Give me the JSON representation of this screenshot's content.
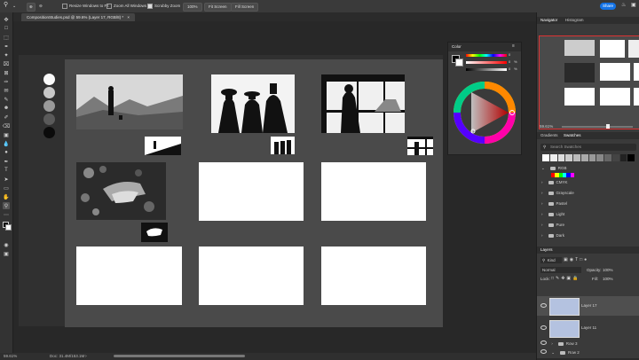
{
  "options_bar": {
    "resize_windows_label": "Resize Windows to Fit",
    "zoom_all_label": "Zoom All Windows",
    "scrubby_zoom_label": "Scrubby Zoom",
    "zoom_value": "100%",
    "fit_screen_label": "Fit Screen",
    "fill_screen_label": "Fill Screen",
    "share_label": "Share"
  },
  "document": {
    "tab_title": "CompositionStudies.psd @ 59.6% (Layer 17, RGB/8) *"
  },
  "status_bar": {
    "zoom": "59.61%",
    "doc_size": "Doc: 31.4M/153.1M"
  },
  "color_panel": {
    "title": "Color",
    "h_value": "0",
    "s_value": "0",
    "b_value": "0",
    "unit": "%"
  },
  "navigator": {
    "tab_navigator": "Navigator",
    "tab_histogram": "Histogram",
    "zoom": "59.61%"
  },
  "swatches": {
    "tab_gradients": "Gradients",
    "tab_swatches": "Swatches",
    "search_placeholder": "Search Swatches",
    "groups": [
      "RGB",
      "CMYK",
      "Grayscale",
      "Pastel",
      "Light",
      "Pure",
      "Dark"
    ]
  },
  "layers": {
    "title": "Layers",
    "kind_label": "Kind",
    "blend_mode": "Normal",
    "opacity_label": "Opacity:",
    "opacity_value": "100%",
    "lock_label": "Lock:",
    "fill_label": "Fill:",
    "fill_value": "100%",
    "items": [
      "Layer 17",
      "Layer 11",
      "Row 3",
      "Row 2"
    ]
  },
  "colors": {
    "accent": "#1473e6",
    "panel": "#3a3a3a",
    "canvas_bg": "#4a4a4a"
  }
}
